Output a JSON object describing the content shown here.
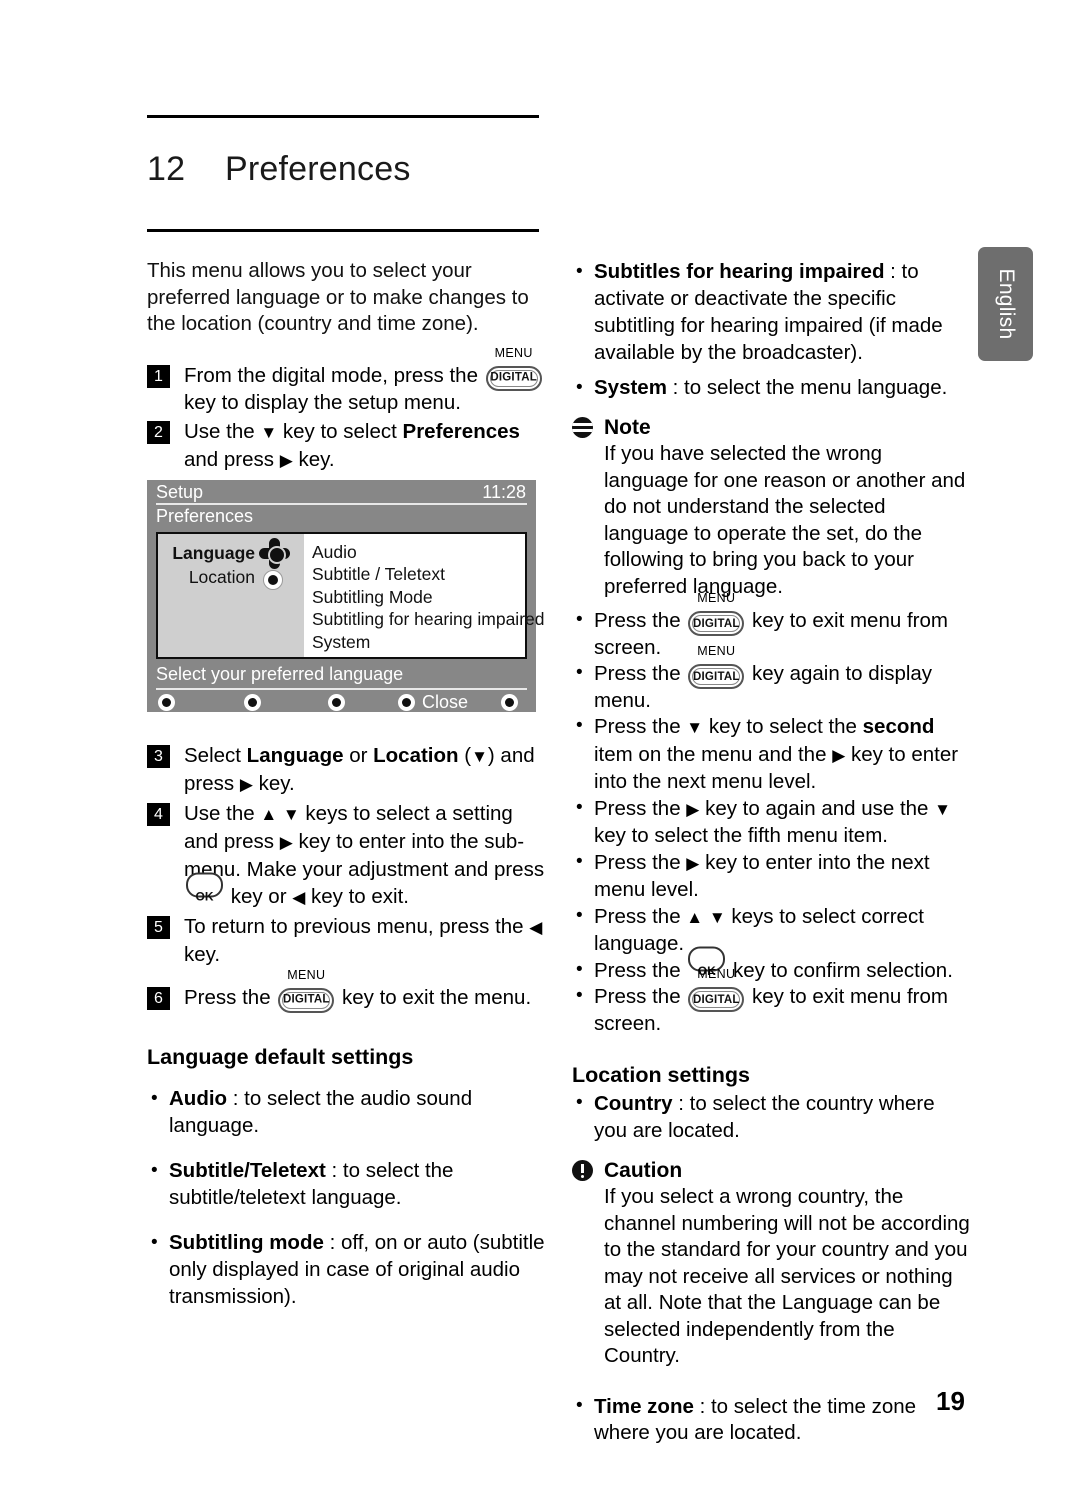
{
  "document": {
    "chapter_number": "12",
    "chapter_title": "Preferences",
    "page_number": "19",
    "side_tab_label": "English"
  },
  "left_column": {
    "intro": "This menu allows you to select your preferred language or to make changes to the location (country and time zone).",
    "steps": [
      {
        "num": "1",
        "text_before": "From the digital mode, press the ",
        "text_after": " key to display the setup menu.",
        "has_key": "digital-menu-key"
      },
      {
        "num": "2",
        "text": "Use the ▼ key to select Preferences and press ▶ key.",
        "bold_word": "Preferences"
      },
      {
        "num": "3",
        "text": "Select Language or Location (▼) and press ▶ key."
      },
      {
        "num": "4",
        "text_a": "Use the ▲ ▼ keys to select a setting and press ▶ key to enter into the sub-menu. Make your adjustment and press ",
        "text_b": " key or ◀ key to exit.",
        "has_key": "ok-key"
      },
      {
        "num": "5",
        "text": "To return to previous menu, press the ◀ key."
      },
      {
        "num": "6",
        "text_before": "Press the ",
        "text_after": " key to exit the menu.",
        "has_key": "digital-menu-key"
      }
    ],
    "tv_menu": {
      "title": "Setup",
      "clock": "11:28",
      "subtitle": "Preferences",
      "left_items": [
        "Language",
        "Location"
      ],
      "right_items": [
        "Audio",
        "Subtitle / Teletext",
        "Subtitling Mode",
        "Subtitling for hearing impaired",
        "System"
      ],
      "hint": "Select your preferred language",
      "close_label": "Close",
      "dot_count": 5,
      "bg_color": "#878787",
      "panel_left_color": "#cfcfcf",
      "panel_right_color": "#ffffff"
    },
    "language_defaults": {
      "heading": "Language default settings",
      "items": [
        {
          "term": "Audio",
          "desc": " : to select the audio sound language."
        },
        {
          "term": "Subtitle/Teletext",
          "desc": " : to select the subtitle/teletext language."
        },
        {
          "term": "Subtitling mode",
          "desc": " : off, on or auto (subtitle only displayed in case of original audio transmission)."
        }
      ]
    }
  },
  "right_column": {
    "top_items": [
      {
        "term": "Subtitles for hearing impaired",
        "desc": " : to activate or deactivate the specific subtitling for hearing impaired (if made available by the broadcaster)."
      },
      {
        "term": "System",
        "desc": " : to select the menu language."
      }
    ],
    "note": {
      "heading": "Note",
      "body": "If you have selected the wrong language for one reason or another and do not understand the selected language to operate the set, do the following to bring you back to your preferred language.",
      "bullets": [
        {
          "before": "Press the ",
          "after": " key to exit menu from screen.",
          "key": "digital-menu-key"
        },
        {
          "before": "Press the ",
          "after": " key again to display menu.",
          "key": "digital-menu-key"
        },
        {
          "text": "Press the ▼ key to select the second item on the menu and the ▶ key to enter into the next menu level.",
          "bold_word": "second"
        },
        {
          "text": "Press the ▶ key to again and use the ▼ key to select the fifth menu item."
        },
        {
          "text": "Press the ▶ key to enter into the next menu level."
        },
        {
          "text": "Press the ▲ ▼ keys to select correct language."
        },
        {
          "before": "Press the ",
          "after": " key to confirm selection.",
          "key": "ok-key"
        },
        {
          "before": "Press the ",
          "after": " key to exit menu from screen.",
          "key": "digital-menu-key"
        }
      ]
    },
    "location_settings": {
      "heading": "Location settings",
      "country": {
        "term": "Country",
        "desc": " : to select the country where you are located."
      },
      "caution": {
        "heading": "Caution",
        "body": "If you select a wrong country, the channel numbering will not be according to the standard for your country and you may not receive all services or nothing at all. Note that the Language can be selected independently from the Country."
      },
      "time_zone": {
        "term": "Time zone",
        "desc": " : to select the time zone where you are located."
      }
    }
  },
  "key_icons": {
    "digital_label": "DIGITAL",
    "menu_label": "MENU",
    "ok_label": "OK"
  }
}
